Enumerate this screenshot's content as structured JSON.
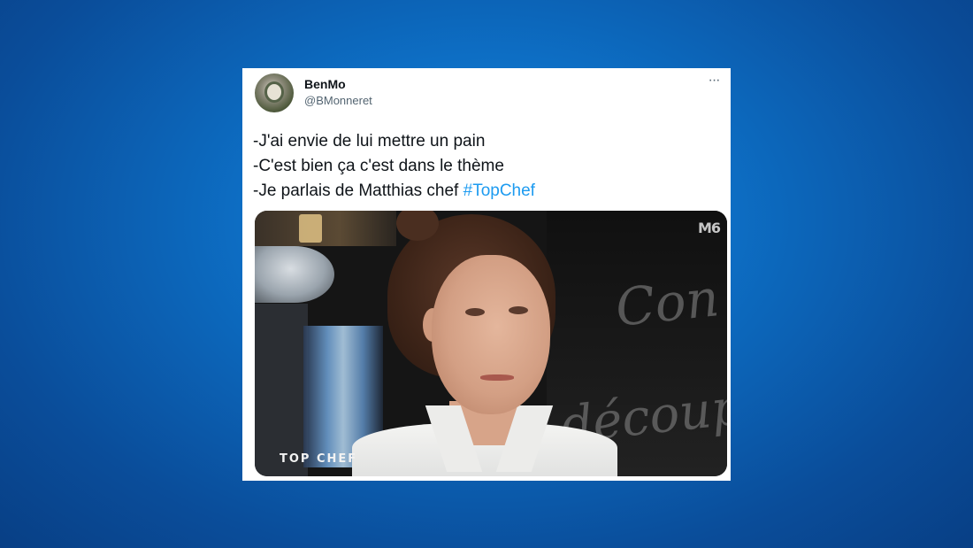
{
  "tweet": {
    "user": {
      "name": "BenMo",
      "handle": "@BMonneret"
    },
    "more_label": "···",
    "text_lines": [
      "-J'ai envie de lui mettre un pain",
      "-C'est bien ça c'est dans le thème"
    ],
    "last_line_prefix": "-Je parlais de Matthias chef ",
    "hashtag": "#TopChef",
    "media": {
      "channel_logo": "M6",
      "show_logo": "TOP CHEF"
    }
  },
  "colors": {
    "background_blue": "#0d6ec4",
    "hashtag_blue": "#1d9bf0",
    "text_dark": "#0f1419",
    "text_gray": "#536471"
  },
  "icons": {
    "more": "more-horizontal-icon",
    "avatar": "avatar"
  }
}
